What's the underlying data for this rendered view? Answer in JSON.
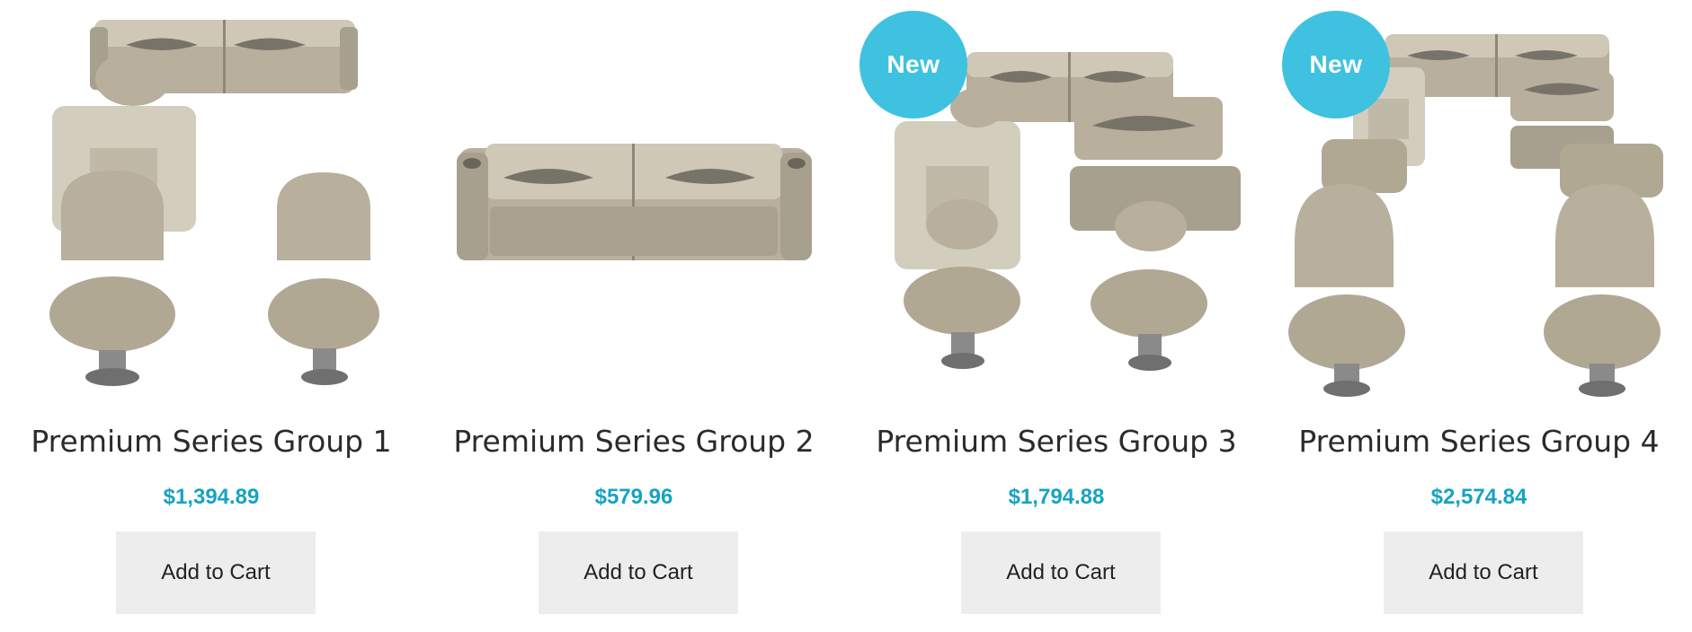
{
  "products": [
    {
      "title": "Premium Series Group 1",
      "price": "$1,394.89",
      "button": "Add to Cart"
    },
    {
      "title": "Premium Series Group 2",
      "price": "$579.96",
      "button": "Add to Cart"
    },
    {
      "title": "Premium Series Group 3",
      "price": "$1,794.88",
      "button": "Add to Cart",
      "badge": "New"
    },
    {
      "title": "Premium Series Group 4",
      "price": "$2,574.84",
      "button": "Add to Cart",
      "badge": "New"
    }
  ],
  "colors": {
    "price": "#16a3c3",
    "badge": "#3fc1e0",
    "button_bg": "#ededed",
    "seat_main": "#b8af9c",
    "seat_dark": "#8f887a",
    "seat_accent": "#787368"
  }
}
